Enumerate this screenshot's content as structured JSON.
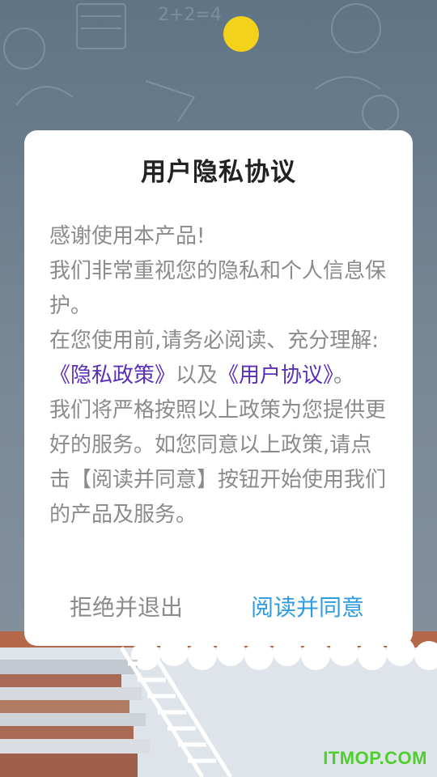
{
  "dialog": {
    "title": "用户隐私协议",
    "body": {
      "line1": "感谢使用本产品!",
      "line2": "我们非常重视您的隐私和个人信息保护。",
      "line3": "在您使用前,请务必阅读、充分理解:",
      "privacy_link": "《隐私政策》",
      "connector": "以及",
      "user_link": "《用户协议》",
      "period": "。",
      "line5": "我们将严格按照以上政策为您提供更好的服务。如您同意以上政策,请点击【阅读并同意】按钮开始使用我们的产品及服务。"
    },
    "reject_label": "拒绝并退出",
    "agree_label": "阅读并同意"
  },
  "watermark": "ITMOP.COM",
  "colors": {
    "link": "#5a2fb8",
    "agree": "#2f9be0",
    "text": "#8b8b8b",
    "title": "#222222",
    "watermark": "#4fcf2e"
  }
}
